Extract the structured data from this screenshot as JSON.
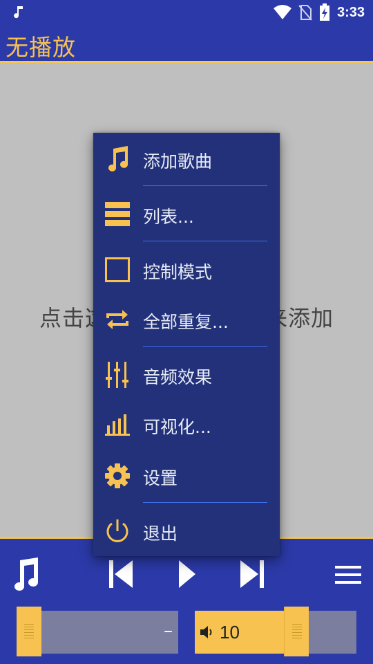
{
  "status_bar": {
    "time": "3:33",
    "icons": [
      "music-note-icon",
      "wifi-icon",
      "no-sim-icon",
      "battery-charging-icon"
    ]
  },
  "app": {
    "title": "无播放"
  },
  "content": {
    "hint_left": "点击这",
    "hint_right": "来添加"
  },
  "menu": {
    "items": [
      {
        "label": "添加歌曲",
        "icon": "music-note-icon"
      },
      {
        "label": "列表...",
        "icon": "list-icon"
      },
      {
        "label": "控制模式",
        "icon": "square-icon"
      },
      {
        "label": "全部重复...",
        "icon": "repeat-icon"
      },
      {
        "label": "音频效果",
        "icon": "equalizer-icon"
      },
      {
        "label": "可视化...",
        "icon": "bar-chart-icon"
      },
      {
        "label": "设置",
        "icon": "gear-icon"
      },
      {
        "label": "退出",
        "icon": "power-icon"
      }
    ]
  },
  "player": {
    "seek_time": "–",
    "volume": "10",
    "volume_level_fraction": 0.55
  },
  "colors": {
    "bar_blue": "#2b3aa8",
    "menu_blue": "#22317a",
    "accent_yellow": "#f7c24f",
    "separator_blue": "#3f6ee8"
  }
}
